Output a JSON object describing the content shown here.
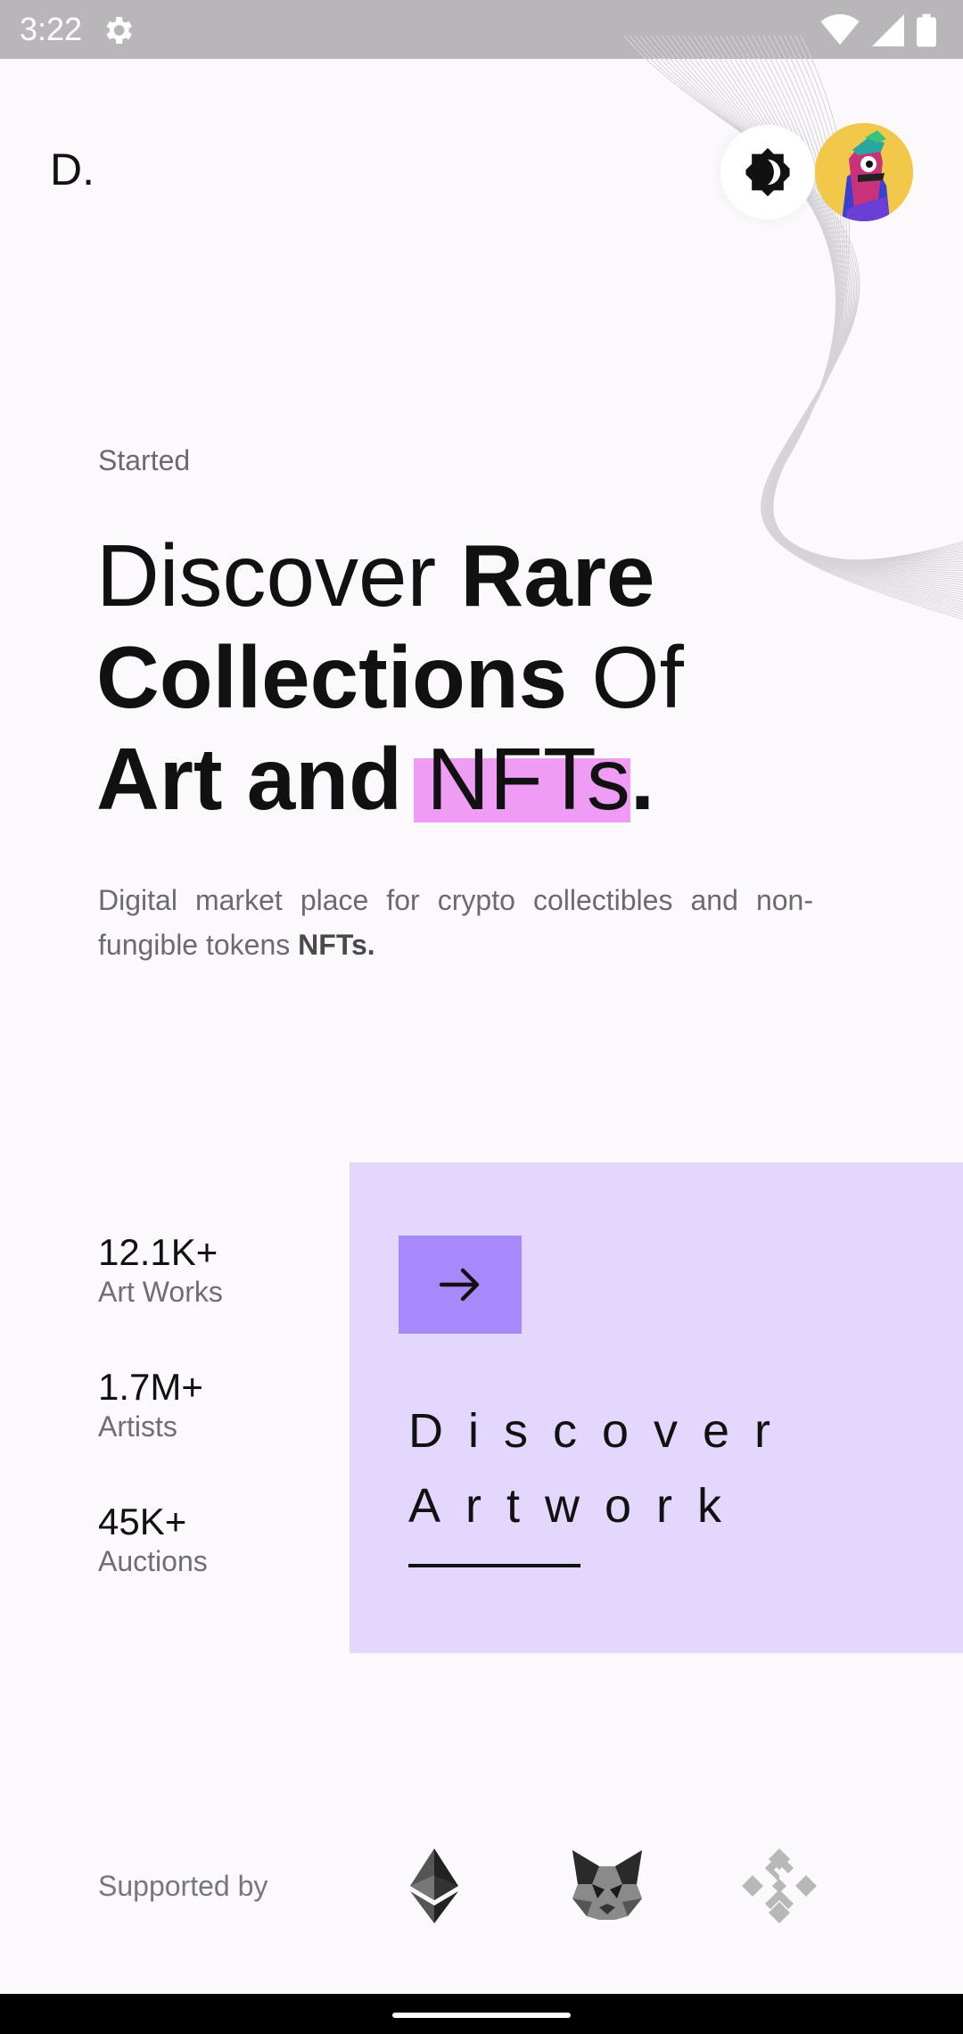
{
  "status_bar": {
    "time": "3:22"
  },
  "header": {
    "logo": "D."
  },
  "hero": {
    "eyebrow": "Started",
    "headline": {
      "w1": "Discover ",
      "w2": "Rare",
      "w3": "Collections",
      "w4": " Of",
      "w5": "Art and ",
      "w6": "NFTs",
      "w7": "."
    },
    "description": "Digital market place for crypto collectibles and non-fungible tokens ",
    "description_bold": "NFTs."
  },
  "stats": [
    {
      "value": "12.1K+",
      "label": "Art Works"
    },
    {
      "value": "1.7M+",
      "label": "Artists"
    },
    {
      "value": "45K+",
      "label": "Auctions"
    }
  ],
  "discover_card": {
    "line1": "Discover",
    "line2": "Artwork",
    "background": "#e3d7fe",
    "button_color": "#a789fb",
    "icon": "arrow-right-icon"
  },
  "highlight_color": "#ee9cf4",
  "footer": {
    "supported_by": "Supported by",
    "partners": [
      "ethereum-icon",
      "metamask-fox-icon",
      "binance-icon"
    ]
  }
}
